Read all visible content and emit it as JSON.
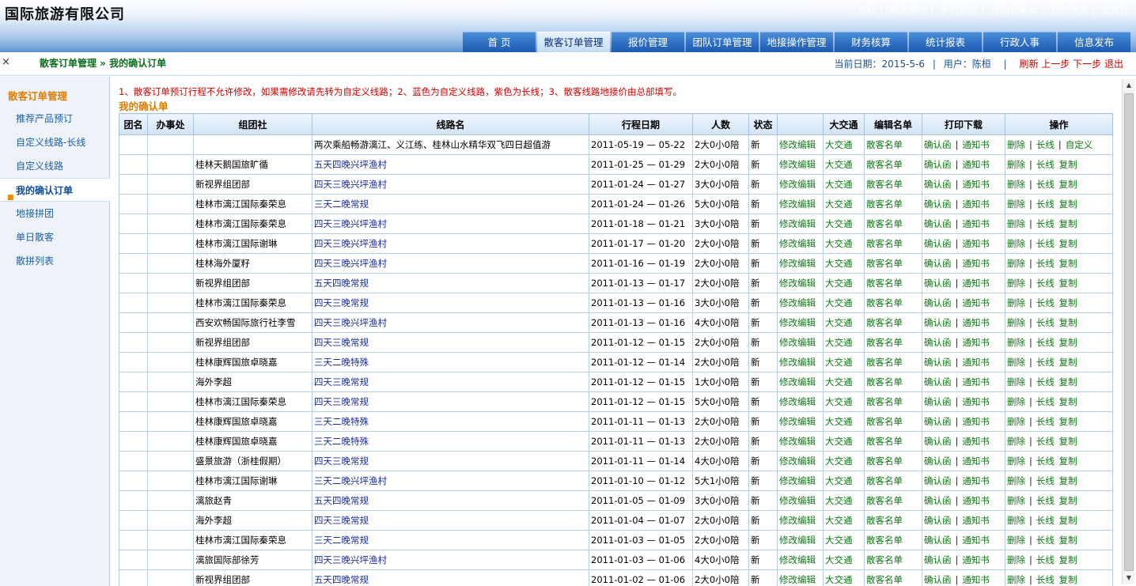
{
  "header": {
    "title": "国际旅游有限公司",
    "toplinks": [
      "论坛",
      "群发邮件",
      "手机短信",
      "我的记事本",
      "我的消息",
      "公告栏"
    ],
    "nav": [
      "首 页",
      "散客订单管理",
      "报价管理",
      "团队订单管理",
      "地接操作管理",
      "财务核算",
      "统计报表",
      "行政人事",
      "信息发布"
    ],
    "nav_active": 1
  },
  "subbar": {
    "close": "×",
    "breadcrumb": "散客订单管理 » 我的确认订单",
    "date_label": "当前日期：2015-5-6",
    "user_label": "用户：陈桓",
    "pipe": "|",
    "actions": [
      "刷新",
      "上一步",
      "下一步",
      "退出"
    ]
  },
  "sidebar": {
    "title": "散客订单管理",
    "items": [
      "推荐产品预订",
      "自定义线路-长线",
      "自定义线路",
      "我的确认订单",
      "地接拼团",
      "单日散客",
      "散拼列表"
    ],
    "active": 3,
    "dot": "■"
  },
  "main": {
    "notice": "1、散客订单预订行程不允许修改，如果需修改请先转为自定义线路；2、蓝色为自定义线路，紫色为长线；3、散客线路地接价由总部填写。",
    "subtitle": "我的确认单",
    "columns": [
      "团名",
      "办事处",
      "组团社",
      "线路名",
      "行程日期",
      "人数",
      "状态",
      "",
      "大交通",
      "编辑名单",
      "打印下载",
      "操作"
    ],
    "link_labels": {
      "edit": "修改编辑",
      "traffic": "大交通",
      "names": "散客名单",
      "confirm": "确认函",
      "notice": "通知书",
      "delete": "删除",
      "longline": "长线",
      "copy": "复制",
      "custom": "自定义",
      "sep": "|"
    },
    "rows": [
      {
        "agency": "",
        "route": "两次乘船畅游漓江、义江练、桂林山水精华双飞四日超值游",
        "date": "2011-05-19 — 05-22",
        "people": "2大0小0陪",
        "status": "新",
        "last": "自定义",
        "plain": true
      },
      {
        "agency": "桂林天鹅国旅旷循",
        "route": "五天四晚兴坪渔村",
        "date": "2011-01-25 — 01-29",
        "people": "2大0小0陪",
        "status": "新",
        "last": "复制"
      },
      {
        "agency": "新视界组团部",
        "route": "四天三晚兴坪渔村",
        "date": "2011-01-24 — 01-27",
        "people": "3大0小0陪",
        "status": "新",
        "last": "复制"
      },
      {
        "agency": "桂林市漓江国际秦荣息",
        "route": "三天二晚常规",
        "date": "2011-01-24 — 01-26",
        "people": "5大0小0陪",
        "status": "新",
        "last": "复制"
      },
      {
        "agency": "桂林市漓江国际秦荣息",
        "route": "四天三晚兴坪渔村",
        "date": "2011-01-18 — 01-21",
        "people": "3大0小0陪",
        "status": "新",
        "last": "复制"
      },
      {
        "agency": "桂林市漓江国际谢琳",
        "route": "四天三晚兴坪渔村",
        "date": "2011-01-17 — 01-20",
        "people": "2大0小0陪",
        "status": "新",
        "last": "复制"
      },
      {
        "agency": "桂林海外厦籽",
        "route": "四天三晚兴坪渔村",
        "date": "2011-01-16 — 01-19",
        "people": "2大0小0陪",
        "status": "新",
        "last": "复制"
      },
      {
        "agency": "新视界组团部",
        "route": "五天四晚常规",
        "date": "2011-01-13 — 01-17",
        "people": "2大0小0陪",
        "status": "新",
        "last": "复制"
      },
      {
        "agency": "桂林市漓江国际秦荣息",
        "route": "四天三晚常规",
        "date": "2011-01-13 — 01-16",
        "people": "3大0小0陪",
        "status": "新",
        "last": "复制"
      },
      {
        "agency": "西安欢畅国际旅行社李雪",
        "route": "四天三晚兴坪渔村",
        "date": "2011-01-13 — 01-16",
        "people": "4大0小0陪",
        "status": "新",
        "last": "复制"
      },
      {
        "agency": "新视界组团部",
        "route": "四天三晚常规",
        "date": "2011-01-12 — 01-15",
        "people": "2大0小0陪",
        "status": "新",
        "last": "复制"
      },
      {
        "agency": "桂林康辉国旅卓晓嘉",
        "route": "三天二晚特殊",
        "date": "2011-01-12 — 01-14",
        "people": "2大0小0陪",
        "status": "新",
        "last": "复制"
      },
      {
        "agency": "海外李超",
        "route": "四天三晚常规",
        "date": "2011-01-12 — 01-15",
        "people": "1大0小0陪",
        "status": "新",
        "last": "复制"
      },
      {
        "agency": "桂林市漓江国际秦荣息",
        "route": "四天三晚常规",
        "date": "2011-01-12 — 01-15",
        "people": "5大0小0陪",
        "status": "新",
        "last": "复制"
      },
      {
        "agency": "桂林康辉国旅卓晓嘉",
        "route": "三天二晚特殊",
        "date": "2011-01-11 — 01-13",
        "people": "2大0小0陪",
        "status": "新",
        "last": "复制"
      },
      {
        "agency": "桂林康辉国旅卓晓嘉",
        "route": "三天二晚特殊",
        "date": "2011-01-11 — 01-13",
        "people": "2大0小0陪",
        "status": "新",
        "last": "复制"
      },
      {
        "agency": "盛景旅游（浙桂假期）",
        "route": "四天三晚常规",
        "date": "2011-01-11 — 01-14",
        "people": "4大0小0陪",
        "status": "新",
        "last": "复制"
      },
      {
        "agency": "桂林市漓江国际谢琳",
        "route": "三天二晚兴坪渔村",
        "date": "2011-01-10 — 01-12",
        "people": "5大1小0陪",
        "status": "新",
        "last": "复制"
      },
      {
        "agency": "漓旅赵青",
        "route": "五天四晚常规",
        "date": "2011-01-05 — 01-09",
        "people": "3大0小0陪",
        "status": "新",
        "last": "复制"
      },
      {
        "agency": "海外李超",
        "route": "四天三晚常规",
        "date": "2011-01-04 — 01-07",
        "people": "2大0小0陪",
        "status": "新",
        "last": "复制"
      },
      {
        "agency": "桂林市漓江国际秦荣息",
        "route": "三天二晚常规",
        "date": "2011-01-03 — 01-05",
        "people": "2大0小0陪",
        "status": "新",
        "last": "复制"
      },
      {
        "agency": "漓旅国际部徐芳",
        "route": "四天三晚兴坪渔村",
        "date": "2011-01-03 — 01-06",
        "people": "4大0小0陪",
        "status": "新",
        "last": "复制"
      },
      {
        "agency": "新视界组团部",
        "route": "五天四晚常规",
        "date": "2011-01-02 — 01-06",
        "people": "2大0小0陪",
        "status": "新",
        "last": "复制"
      }
    ]
  },
  "scrollbar": {
    "up": "▲",
    "down": "▼"
  }
}
